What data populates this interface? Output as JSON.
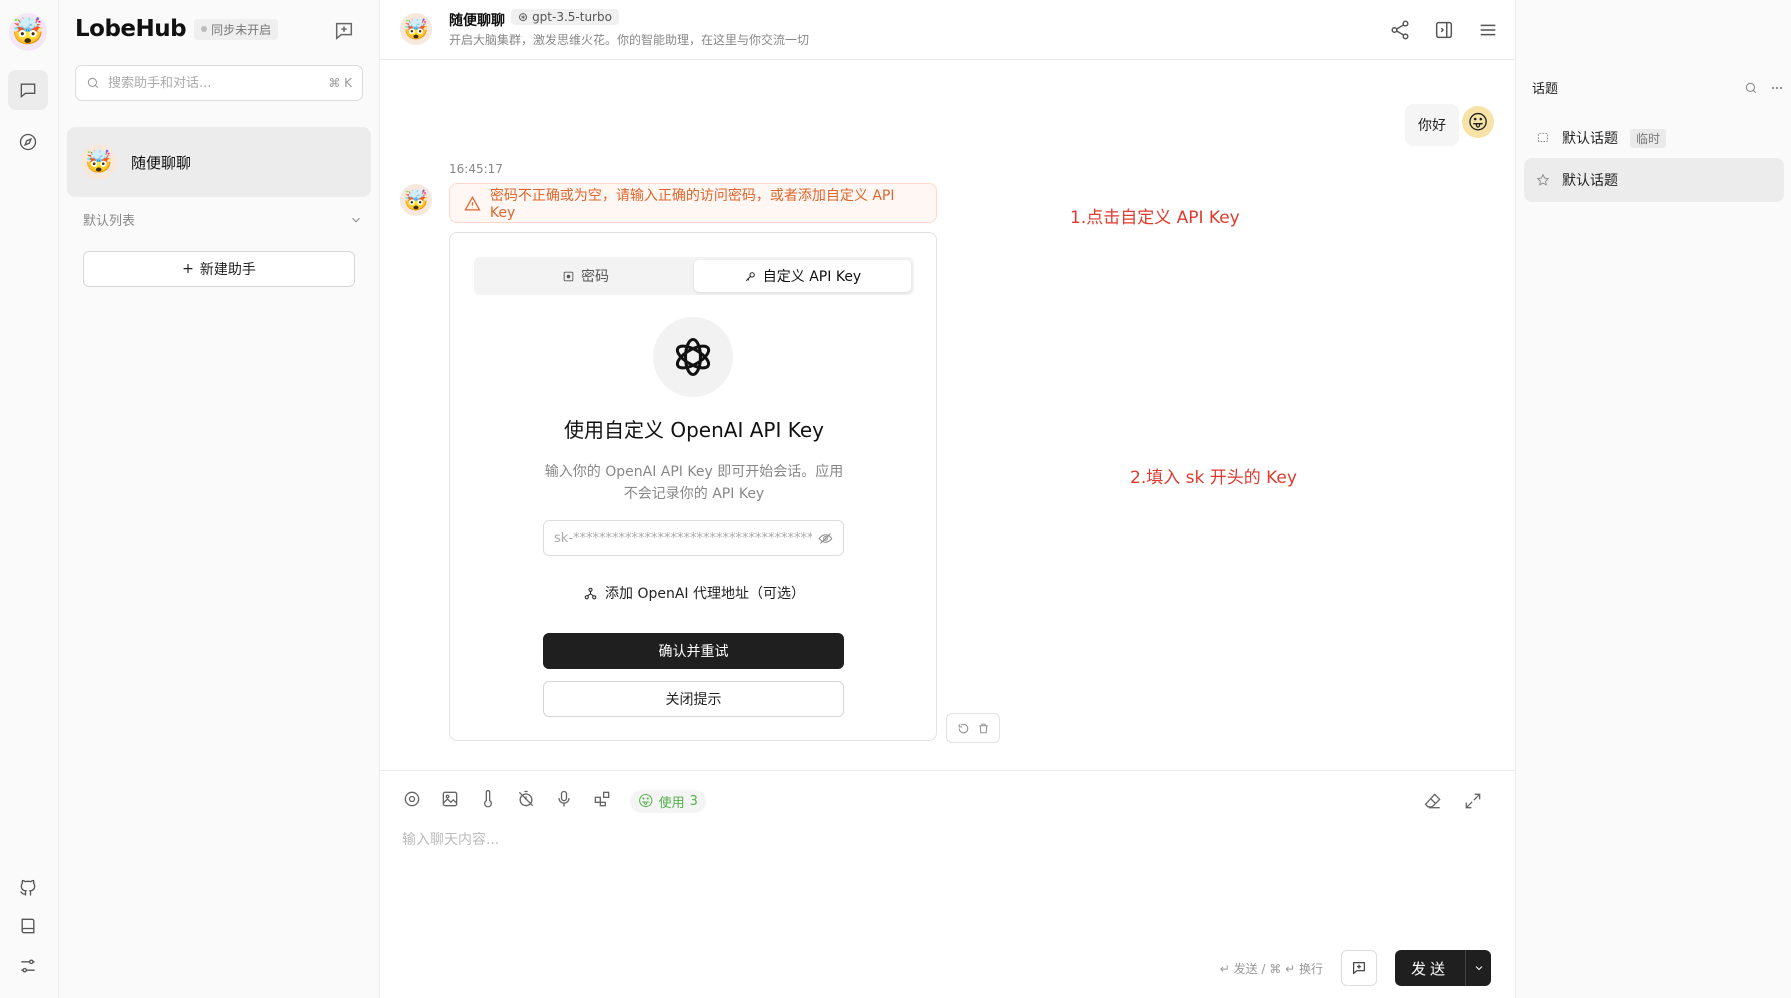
{
  "app": {
    "brand": "LobeHub",
    "sync_status": "同步未开启"
  },
  "rail": {
    "items": [
      {
        "name": "chat",
        "icon": "chat-bubble-icon",
        "active": true
      },
      {
        "name": "discover",
        "icon": "compass-icon",
        "active": false
      }
    ],
    "bottom": [
      {
        "icon": "github-icon"
      },
      {
        "icon": "book-icon"
      },
      {
        "icon": "settings-sliders-icon"
      }
    ]
  },
  "sessions": {
    "search_placeholder": "搜索助手和对话...",
    "search_shortcut": "⌘ K",
    "active_session": "随便聊聊",
    "group_label": "默认列表",
    "add_assistant": "新建助手"
  },
  "chat_header": {
    "title": "随便聊聊",
    "model": "gpt-3.5-turbo",
    "description": "开启大脑集群，激发思维火花。你的智能助理，在这里与你交流一切"
  },
  "messages": {
    "user_text": "你好",
    "timestamp": "16:45:17",
    "error_text": "密码不正确或为空，请输入正确的访问密码，或者添加自定义 API Key"
  },
  "key_card": {
    "tab_password": "密码",
    "tab_custom_key": "自定义 API Key",
    "title": "使用自定义 OpenAI API Key",
    "description": "输入你的 OpenAI API Key 即可开始会话。应用不会记录你的 API Key",
    "key_value": "sk-*************************************************",
    "proxy_link": "添加 OpenAI 代理地址（可选）",
    "confirm_button": "确认并重试",
    "close_button": "关闭提示"
  },
  "annotations": {
    "step1": "1.点击自定义 API Key",
    "step2": "2.填入 sk 开头的 Key"
  },
  "input": {
    "usage_label": "使用",
    "usage_count": "3",
    "placeholder": "输入聊天内容...",
    "shortcut_hint": "↵ 发送 / ⌘ ↵ 换行",
    "send_label": "发送"
  },
  "topics": {
    "title": "话题",
    "items": [
      {
        "label": "默认话题",
        "tag": "临时"
      },
      {
        "label": "默认话题",
        "tag": ""
      }
    ]
  },
  "colors": {
    "error": "#e0652c",
    "annotation": "#e03a2e",
    "primary_button": "#1f1f1f",
    "usage_green": "#52b04a"
  }
}
